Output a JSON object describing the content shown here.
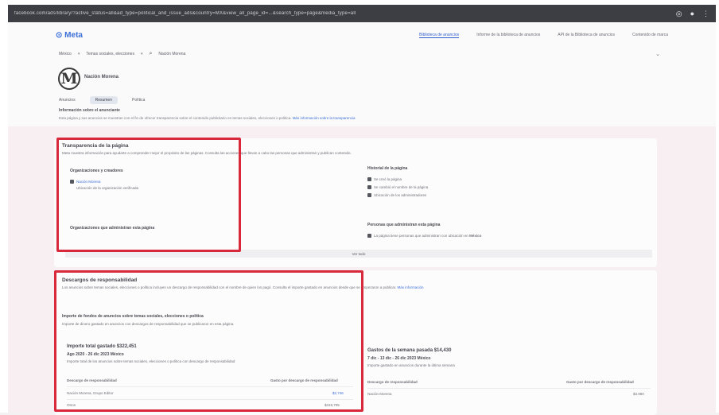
{
  "browser": {
    "url": "facebook.com/ads/library/?active_status=all&ad_type=political_and_issue_ads&country=MX&view_all_page_id=...&search_type=page&media_type=all"
  },
  "header": {
    "brand": "Meta",
    "nav": [
      "Biblioteca de anuncios",
      "Informe de la biblioteca de anuncios",
      "API de la Biblioteca de anuncios",
      "Contenido de marca"
    ]
  },
  "filters": {
    "country": "México",
    "category": "Temas sociales, elecciones",
    "search": "Nación Morena"
  },
  "page": {
    "name": "Nación Morena",
    "avatar_letter": "M",
    "tabs": [
      "Anuncios",
      "Resumen",
      "Política"
    ],
    "active_tab": "Resumen"
  },
  "info": {
    "title": "Información sobre el anunciante",
    "text": "Esta página y sus anuncios se muestran con el fin de ofrecer transparencia sobre el contenido publicitario en temas sociales, elecciones o política.",
    "link": "Más información sobre la transparencia"
  },
  "transparency": {
    "title": "Transparencia de la página",
    "subtitle": "Meta muestra información para ayudarte a comprender mejor el propósito de las páginas. Consulta las acciones que llevan a cabo las personas que administran y publican contenido.",
    "org_title": "Organizaciones y creadores",
    "org_name": "Nación Morena",
    "org_meta": "Ubicación de la organización verificada",
    "admins_title": "Organizaciones que administran esta página",
    "history_title": "Historial de la página",
    "history_items": [
      "Se creó la página",
      "Se cambió el nombre de la página",
      "Ubicación de los administradores"
    ],
    "people_title": "Personas que administran esta página",
    "people_text": "La página tiene personas que administran con ubicación en",
    "people_country": "México",
    "see_all": "Ver todo"
  },
  "disclaimer": {
    "title": "Descargos de responsabilidad",
    "text": "Los anuncios sobre temas sociales, elecciones o política incluyen un descargo de responsabilidad con el nombre de quien los pagó. Consulta el importe gastado en anuncios desde que se empezaron a publicar.",
    "link": "Más información",
    "note_title": "Importe de fondos de anuncios sobre temas sociales, elecciones o política",
    "note_text": "Importe de dinero gastado en anuncios con descargos de responsabilidad que se publicaron en esta página.",
    "total_title": "Importe total gastado",
    "total_value": "$322,451",
    "total_range": "Ago 2020 - 26 dic 2023 México",
    "total_desc": "Importe total de los anuncios sobre temas sociales, elecciones o política con descargo de responsabilidad",
    "week_title": "Gastos de la semana pasada",
    "week_value": "$14,430",
    "week_range": "7 dic - 13 dic - 26 dic 2023 México",
    "week_desc": "Importe gastado en anuncios durante la última semana",
    "col_left": "Descargo de responsabilidad",
    "col_right": "Gasto por descargo de responsabilidad",
    "rows_left": [
      {
        "name": "Nación Morena, Grupo Editor",
        "amount": "$2,746"
      },
      {
        "name": "Otros",
        "amount": "$319,705"
      }
    ],
    "rows_right": [
      {
        "name": "Nación Morena",
        "amount": "$3,980"
      }
    ]
  }
}
